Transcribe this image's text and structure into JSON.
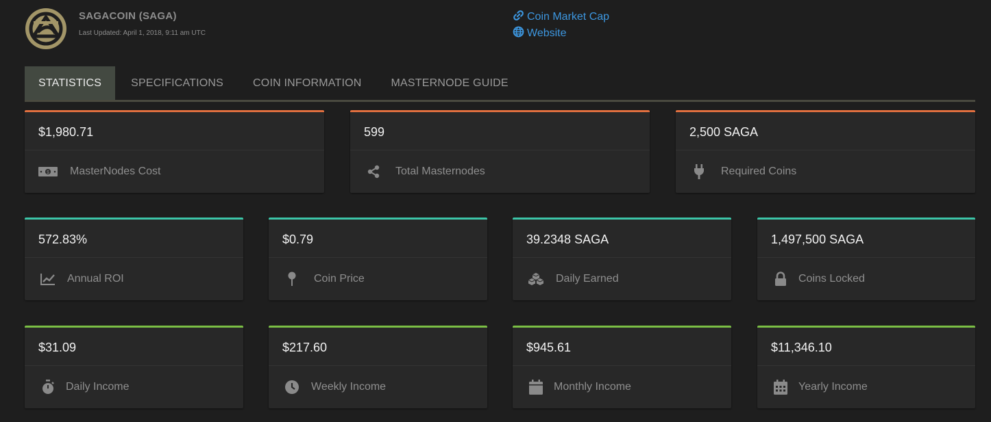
{
  "header": {
    "coin_title": "SAGACOIN (SAGA)",
    "last_updated": "Last Updated: April 1, 2018, 9:11 am UTC",
    "links": [
      {
        "label": "Coin Market Cap",
        "icon": "link-icon"
      },
      {
        "label": "Website",
        "icon": "globe-icon"
      }
    ]
  },
  "tabs": [
    {
      "label": "STATISTICS",
      "active": true
    },
    {
      "label": "SPECIFICATIONS",
      "active": false
    },
    {
      "label": "COIN INFORMATION",
      "active": false
    },
    {
      "label": "MASTERNODE GUIDE",
      "active": false
    }
  ],
  "colors": {
    "orange_accent": "#e06f3f",
    "teal_accent": "#3cc6a8",
    "green_accent": "#7bbf45",
    "link_blue": "#3d97e0"
  },
  "stats_row1": [
    {
      "value": "$1,980.71",
      "label": "MasterNodes Cost",
      "icon": "money-icon"
    },
    {
      "value": "599",
      "label": "Total Masternodes",
      "icon": "share-icon"
    },
    {
      "value": "2,500 SAGA",
      "label": "Required Coins",
      "icon": "plug-icon"
    }
  ],
  "stats_row2": [
    {
      "value": "572.83%",
      "label": "Annual ROI",
      "icon": "chart-line-icon"
    },
    {
      "value": "$0.79",
      "label": "Coin Price",
      "icon": "map-pin-icon"
    },
    {
      "value": "39.2348 SAGA",
      "label": "Daily Earned",
      "icon": "cubes-icon"
    },
    {
      "value": "1,497,500 SAGA",
      "label": "Coins Locked",
      "icon": "lock-icon"
    }
  ],
  "stats_row3": [
    {
      "value": "$31.09",
      "label": "Daily Income",
      "icon": "stopwatch-icon"
    },
    {
      "value": "$217.60",
      "label": "Weekly Income",
      "icon": "clock-icon"
    },
    {
      "value": "$945.61",
      "label": "Monthly Income",
      "icon": "calendar-icon"
    },
    {
      "value": "$11,346.10",
      "label": "Yearly Income",
      "icon": "calendar-grid-icon"
    }
  ]
}
